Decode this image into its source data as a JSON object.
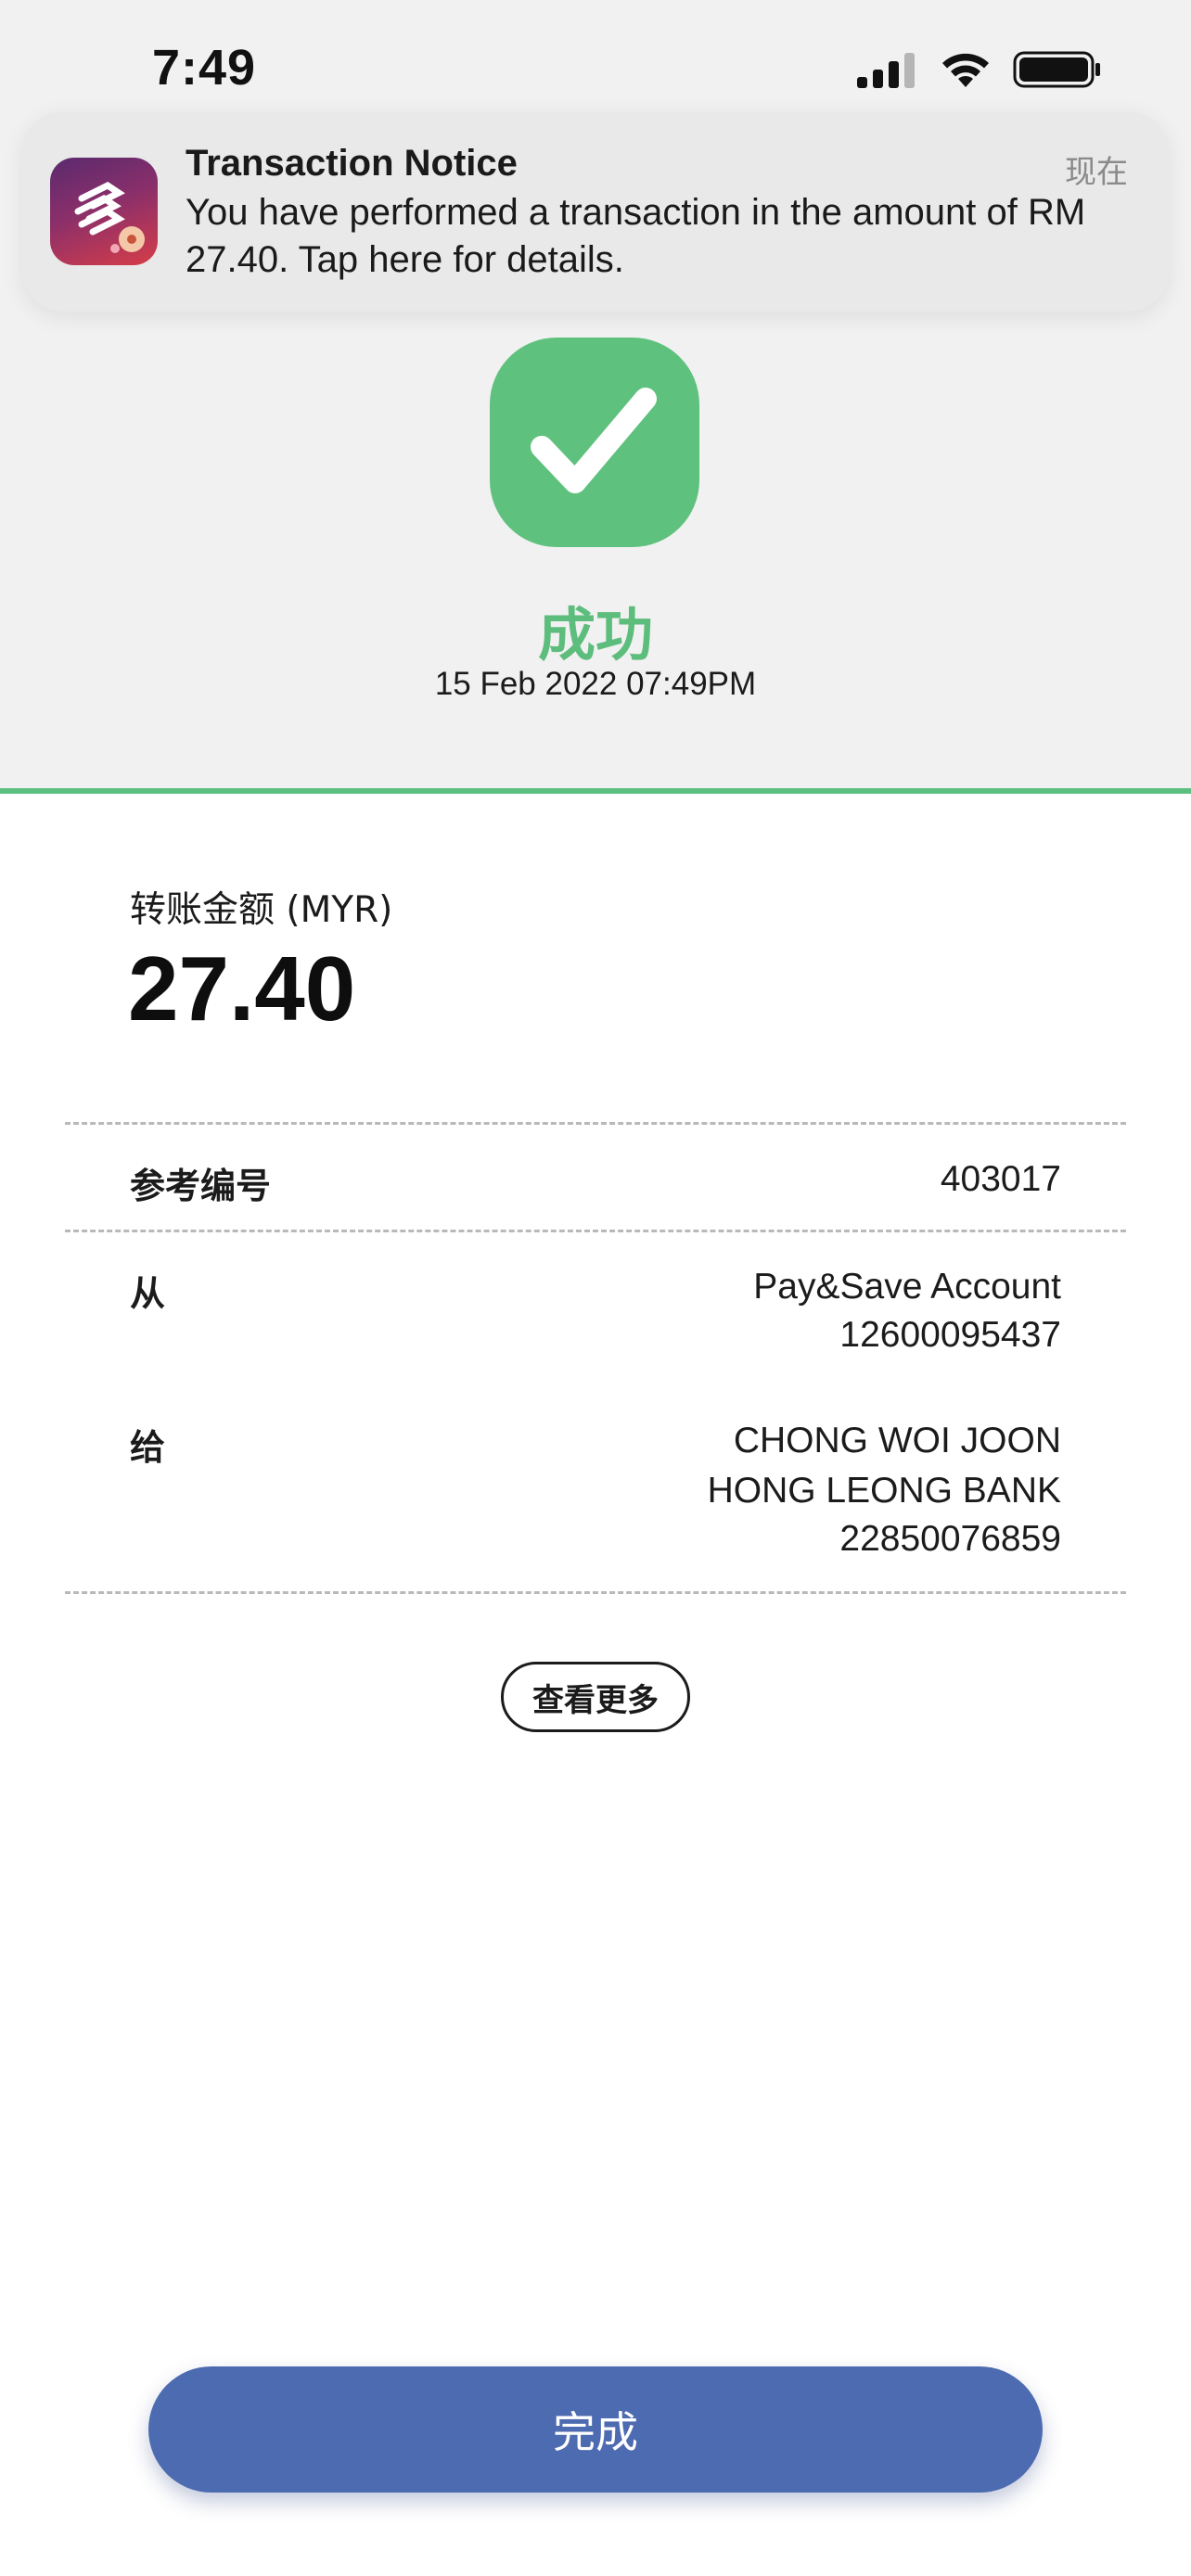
{
  "status_bar": {
    "time": "7:49"
  },
  "notification": {
    "app_icon": "uob-app-icon",
    "title": "Transaction Notice",
    "time": "现在",
    "body": "You have performed a transaction in the amount of RM 27.40. Tap here for details."
  },
  "result": {
    "icon": "checkmark-icon",
    "status": "成功",
    "datetime": "15 Feb 2022 07:49PM"
  },
  "amount": {
    "label": "转账金额 (MYR)",
    "value": "27.40"
  },
  "details": {
    "reference": {
      "label": "参考编号",
      "value": "403017"
    },
    "from": {
      "label": "从",
      "account_name": "Pay&Save Account",
      "account_number": "12600095437"
    },
    "to": {
      "label": "给",
      "name": "CHONG WOI JOON",
      "bank": "HONG LEONG BANK",
      "account_number": "22850076859"
    }
  },
  "view_more_label": "查看更多",
  "done_label": "完成",
  "colors": {
    "success_green": "#5fc17e",
    "primary_button": "#4d6bb1",
    "top_background": "#f1f1f1"
  }
}
